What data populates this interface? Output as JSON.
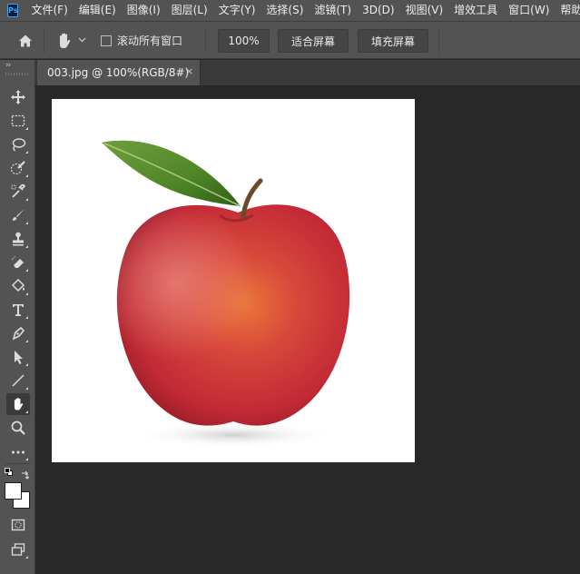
{
  "app": {
    "logo_text": "Ps"
  },
  "menu": {
    "items": [
      {
        "label": "文件(F)"
      },
      {
        "label": "编辑(E)"
      },
      {
        "label": "图像(I)"
      },
      {
        "label": "图层(L)"
      },
      {
        "label": "文字(Y)"
      },
      {
        "label": "选择(S)"
      },
      {
        "label": "滤镜(T)"
      },
      {
        "label": "3D(D)"
      },
      {
        "label": "视图(V)"
      },
      {
        "label": "增效工具"
      },
      {
        "label": "窗口(W)"
      },
      {
        "label": "帮助(H)"
      }
    ]
  },
  "options_bar": {
    "home_icon": "home-icon",
    "active_tool_icon": "hand-icon",
    "scroll_all_windows_label": "滚动所有窗口",
    "scroll_all_windows_checked": false,
    "zoom_100_label": "100%",
    "fit_screen_label": "适合屏幕",
    "fill_screen_label": "填充屏幕"
  },
  "document": {
    "tab_title": "003.jpg @ 100%(RGB/8#)",
    "close_glyph": "×",
    "image_subject": "red apple with green leaf on white background"
  },
  "toolbar": {
    "collapse_glyph": "››",
    "tools": [
      "move-tool-icon",
      "marquee-tool-icon",
      "lasso-tool-icon",
      "quick-selection-tool-icon",
      "eyedropper-tool-icon",
      "brush-tool-icon",
      "stamp-tool-icon",
      "eraser-tool-icon",
      "paint-bucket-tool-icon",
      "type-tool-icon",
      "pen-tool-icon",
      "path-selection-tool-icon",
      "line-tool-icon",
      "hand-tool-icon",
      "zoom-tool-icon",
      "more-tools-icon"
    ],
    "active_tool": "hand-tool-icon",
    "colors": {
      "foreground": "#ffffff",
      "background": "#ffffff"
    }
  },
  "theme": {
    "panel": "#535353",
    "workspace": "#282828",
    "accent_ps": "#31a8ff"
  }
}
